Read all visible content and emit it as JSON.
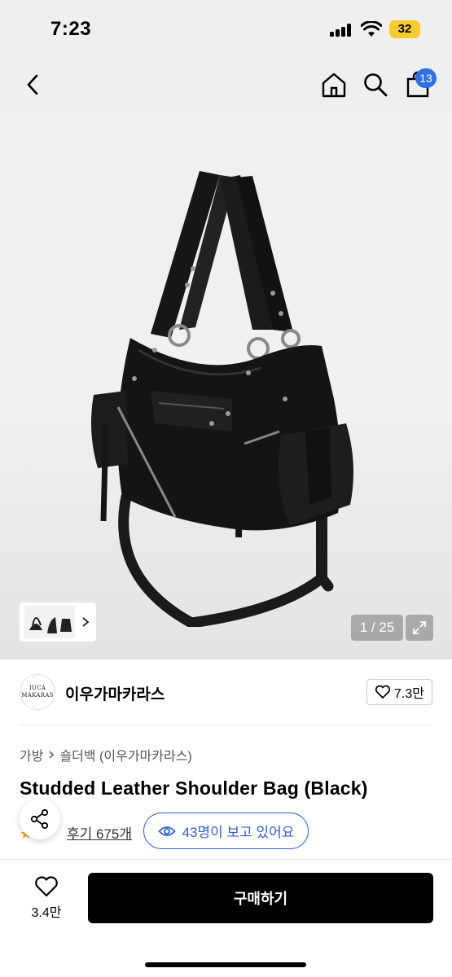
{
  "status_bar": {
    "time": "7:23",
    "battery": "32"
  },
  "header": {
    "back_icon": "chevron-left-icon",
    "home_icon": "home-icon",
    "search_icon": "search-icon",
    "cart_icon": "shopping-bag-icon",
    "cart_count": "13"
  },
  "gallery": {
    "counter": "1 / 25",
    "expand_icon": "expand-icon",
    "thumb_arrow_icon": "chevron-right-icon"
  },
  "brand": {
    "logo_line1": "IUCA",
    "logo_line2": "MAKARAS",
    "name": "이우가마카라스",
    "likes": "7.3만"
  },
  "breadcrumb": {
    "category": "가방",
    "subcategory": "숄더백 (이우가마카라스)"
  },
  "product": {
    "title": "Studded Leather Shoulder Bag (Black)",
    "rating_partial": "5",
    "review_link": "후기 675개",
    "viewing_now": "43명이 보고 있어요"
  },
  "bottom_bar": {
    "wish_count": "3.4만",
    "buy_label": "구매하기"
  },
  "colors": {
    "accent_blue": "#2f5fd6",
    "badge_blue": "#2f6fe8",
    "battery_yellow": "#f7cc2b"
  }
}
